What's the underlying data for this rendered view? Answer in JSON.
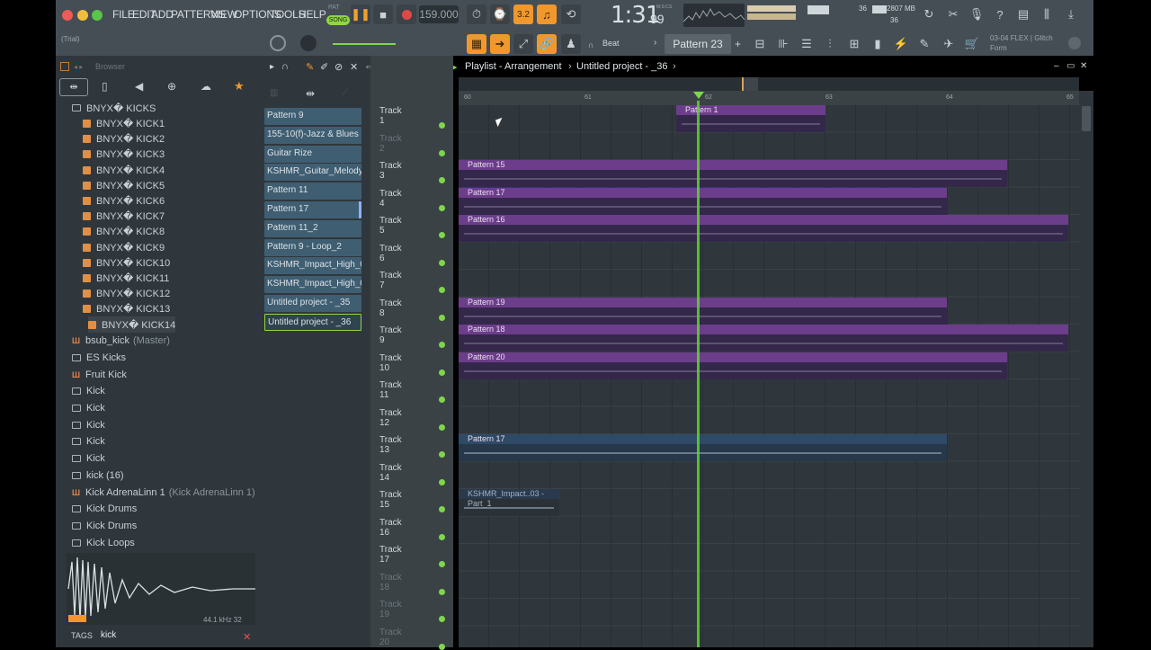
{
  "menu": [
    "FILE",
    "EDIT",
    "ADD",
    "PATTERNS",
    "VIEW",
    "OPTIONS",
    "TOOLS",
    "HELP"
  ],
  "transport": {
    "pat_label": "PAT",
    "song_label": "SONG",
    "tempo": "159.000",
    "time": "1:31",
    "time_sub": "99",
    "time_unit": "M:S:CS",
    "step": "3.2"
  },
  "cpu": {
    "voices": "36",
    "memory": "2807 MB",
    "poly": "36"
  },
  "toolbar2": {
    "trial": "(Trial)",
    "snap": "Beat",
    "pattern": "Pattern 23"
  },
  "hint": {
    "code": "03-04",
    "text": "FLEX | Glitch Form"
  },
  "browser": {
    "title": "Browser",
    "folder": "BNYX\u0000 KICKS",
    "kicks": [
      "BNYX\u0000 KICK1",
      "BNYX\u0000 KICK2",
      "BNYX\u0000 KICK3",
      "BNYX\u0000 KICK4",
      "BNYX\u0000 KICK5",
      "BNYX\u0000 KICK6",
      "BNYX\u0000 KICK7",
      "BNYX\u0000 KICK8",
      "BNYX\u0000 KICK9",
      "BNYX\u0000 KICK10",
      "BNYX\u0000 KICK11",
      "BNYX\u0000 KICK12",
      "BNYX\u0000 KICK13",
      "BNYX\u0000 KICK14"
    ],
    "items": [
      {
        "label": "bsub_kick",
        "note": "(Master)",
        "type": "plugin"
      },
      {
        "label": "ES Kicks",
        "type": "folder"
      },
      {
        "label": "Fruit Kick",
        "type": "plugin"
      },
      {
        "label": "Kick",
        "type": "folder"
      },
      {
        "label": "Kick",
        "type": "folder"
      },
      {
        "label": "Kick",
        "type": "folder"
      },
      {
        "label": "Kick",
        "type": "folder"
      },
      {
        "label": "Kick",
        "type": "folder"
      },
      {
        "label": "kick (16)",
        "type": "folder"
      },
      {
        "label": "Kick AdrenaLinn 1",
        "note": "(Kick AdrenaLinn 1)",
        "type": "plugin"
      },
      {
        "label": "Kick Drums",
        "type": "folder"
      },
      {
        "label": "Kick Drums",
        "type": "folder"
      },
      {
        "label": "Kick Loops",
        "type": "folder"
      }
    ],
    "sample_info": "44.1 kHz 32",
    "tags_label": "TAGS",
    "tags_value": "kick"
  },
  "patterns": [
    "Pattern 9",
    "155-10(f)-Jazz & Blues G...",
    "Guitar Rize",
    "KSHMR_Guitar_Melody_...",
    "Pattern 11",
    "Pattern 17",
    "Pattern 11_2",
    "Pattern 9 - Loop_2",
    "KSHMR_Impact_High_03...",
    "KSHMR_Impact_High_03",
    "Untitled project - _35",
    "Untitled project - _36"
  ],
  "playlist": {
    "title": "Playlist - Arrangement",
    "project": "Untitled project - _36",
    "bars": [
      "60",
      "61",
      "62",
      "63",
      "64",
      "65"
    ]
  },
  "tracks": [
    "Track 1",
    "Track 2",
    "Track 3",
    "Track 4",
    "Track 5",
    "Track 6",
    "Track 7",
    "Track 8",
    "Track 9",
    "Track 10",
    "Track 11",
    "Track 12",
    "Track 13",
    "Track 14",
    "Track 15",
    "Track 16",
    "Track 17",
    "Track 18",
    "Track 19",
    "Track 20"
  ],
  "clips": [
    {
      "label": "Pattern 1",
      "track": 1
    },
    {
      "label": "Pattern 15",
      "track": 3
    },
    {
      "label": "Pattern 17",
      "track": 4
    },
    {
      "label": "Pattern 16",
      "track": 5
    },
    {
      "label": "Pattern 19",
      "track": 8
    },
    {
      "label": "Pattern 18",
      "track": 9
    },
    {
      "label": "Pattern 20",
      "track": 10
    },
    {
      "label": "Pattern 17",
      "track": 13
    },
    {
      "label": "KSHMR_Impact..03 - Part_1",
      "track": 15
    }
  ]
}
